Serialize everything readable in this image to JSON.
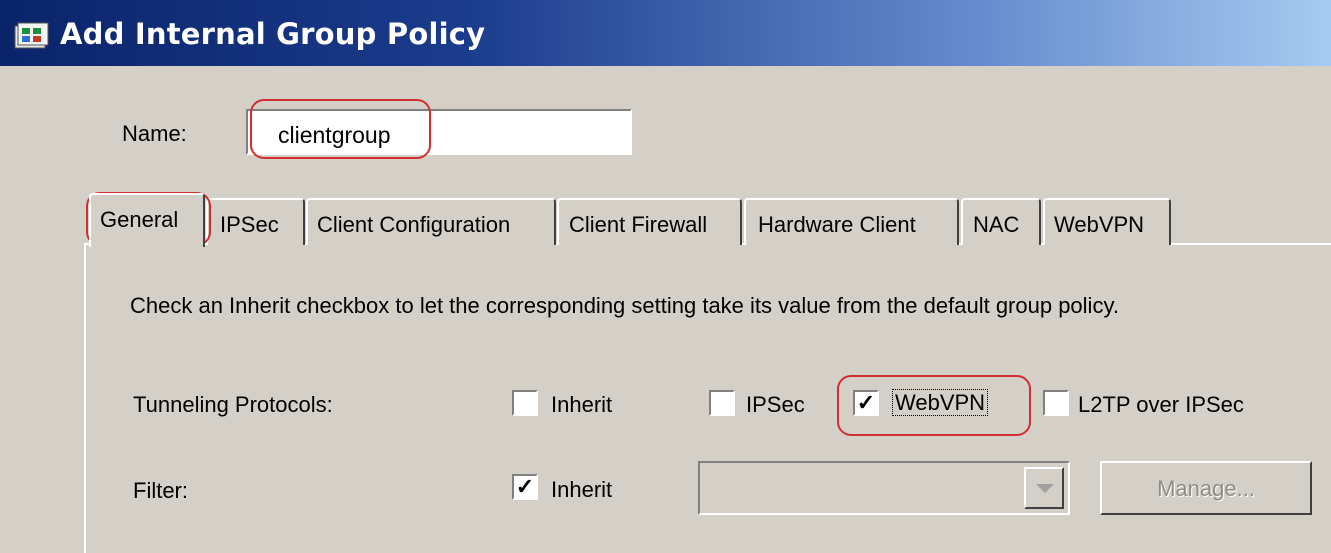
{
  "window": {
    "title": "Add Internal Group Policy",
    "icon": "network-policy-icon"
  },
  "name_field": {
    "label": "Name:",
    "value": "clientgroup"
  },
  "tabs": [
    {
      "label": "General",
      "active": true
    },
    {
      "label": "IPSec"
    },
    {
      "label": "Client Configuration"
    },
    {
      "label": "Client Firewall"
    },
    {
      "label": "Hardware Client"
    },
    {
      "label": "NAC"
    },
    {
      "label": "WebVPN"
    }
  ],
  "general": {
    "instructions": "Check an Inherit checkbox to let the corresponding setting take its value from the default group policy.",
    "tunneling": {
      "label": "Tunneling Protocols:",
      "inherit": {
        "label": "Inherit",
        "checked": false
      },
      "ipsec": {
        "label": "IPSec",
        "checked": false
      },
      "webvpn": {
        "label": "WebVPN",
        "checked": true
      },
      "l2tp": {
        "label": "L2TP over IPSec",
        "checked": false
      }
    },
    "filter": {
      "label": "Filter:",
      "inherit": {
        "label": "Inherit",
        "checked": true
      },
      "select_value": "",
      "manage_label": "Manage..."
    }
  },
  "colors": {
    "highlight": "#d12f2f",
    "titlebar_start": "#0a246a",
    "titlebar_end": "#a6caf0",
    "background": "#d4d0c8"
  }
}
